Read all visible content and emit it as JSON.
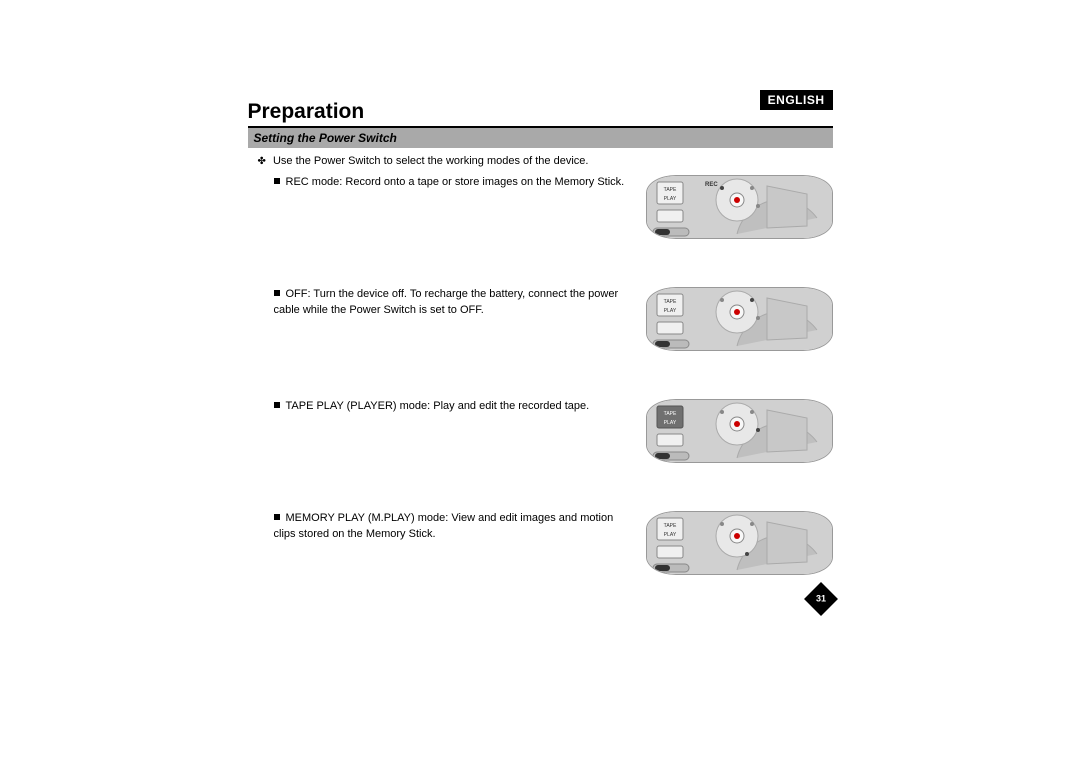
{
  "language": "ENGLISH",
  "title": "Preparation",
  "subtitle": "Setting the Power Switch",
  "intro": "Use the Power Switch to select the working modes of the device.",
  "modes": [
    {
      "text": "REC mode: Record onto a tape or store images on the Memory Stick."
    },
    {
      "text": "OFF: Turn the device off. To recharge the battery, connect the power cable while the Power Switch is set to OFF."
    },
    {
      "text": "TAPE PLAY (PLAYER) mode: Play and edit the recorded tape."
    },
    {
      "text": "MEMORY PLAY (M.PLAY) mode: View and edit images and motion clips stored on the Memory Stick."
    }
  ],
  "page_number": "31",
  "labels": {
    "tape": "TAPE",
    "play": "PLAY",
    "rec": "REC"
  }
}
